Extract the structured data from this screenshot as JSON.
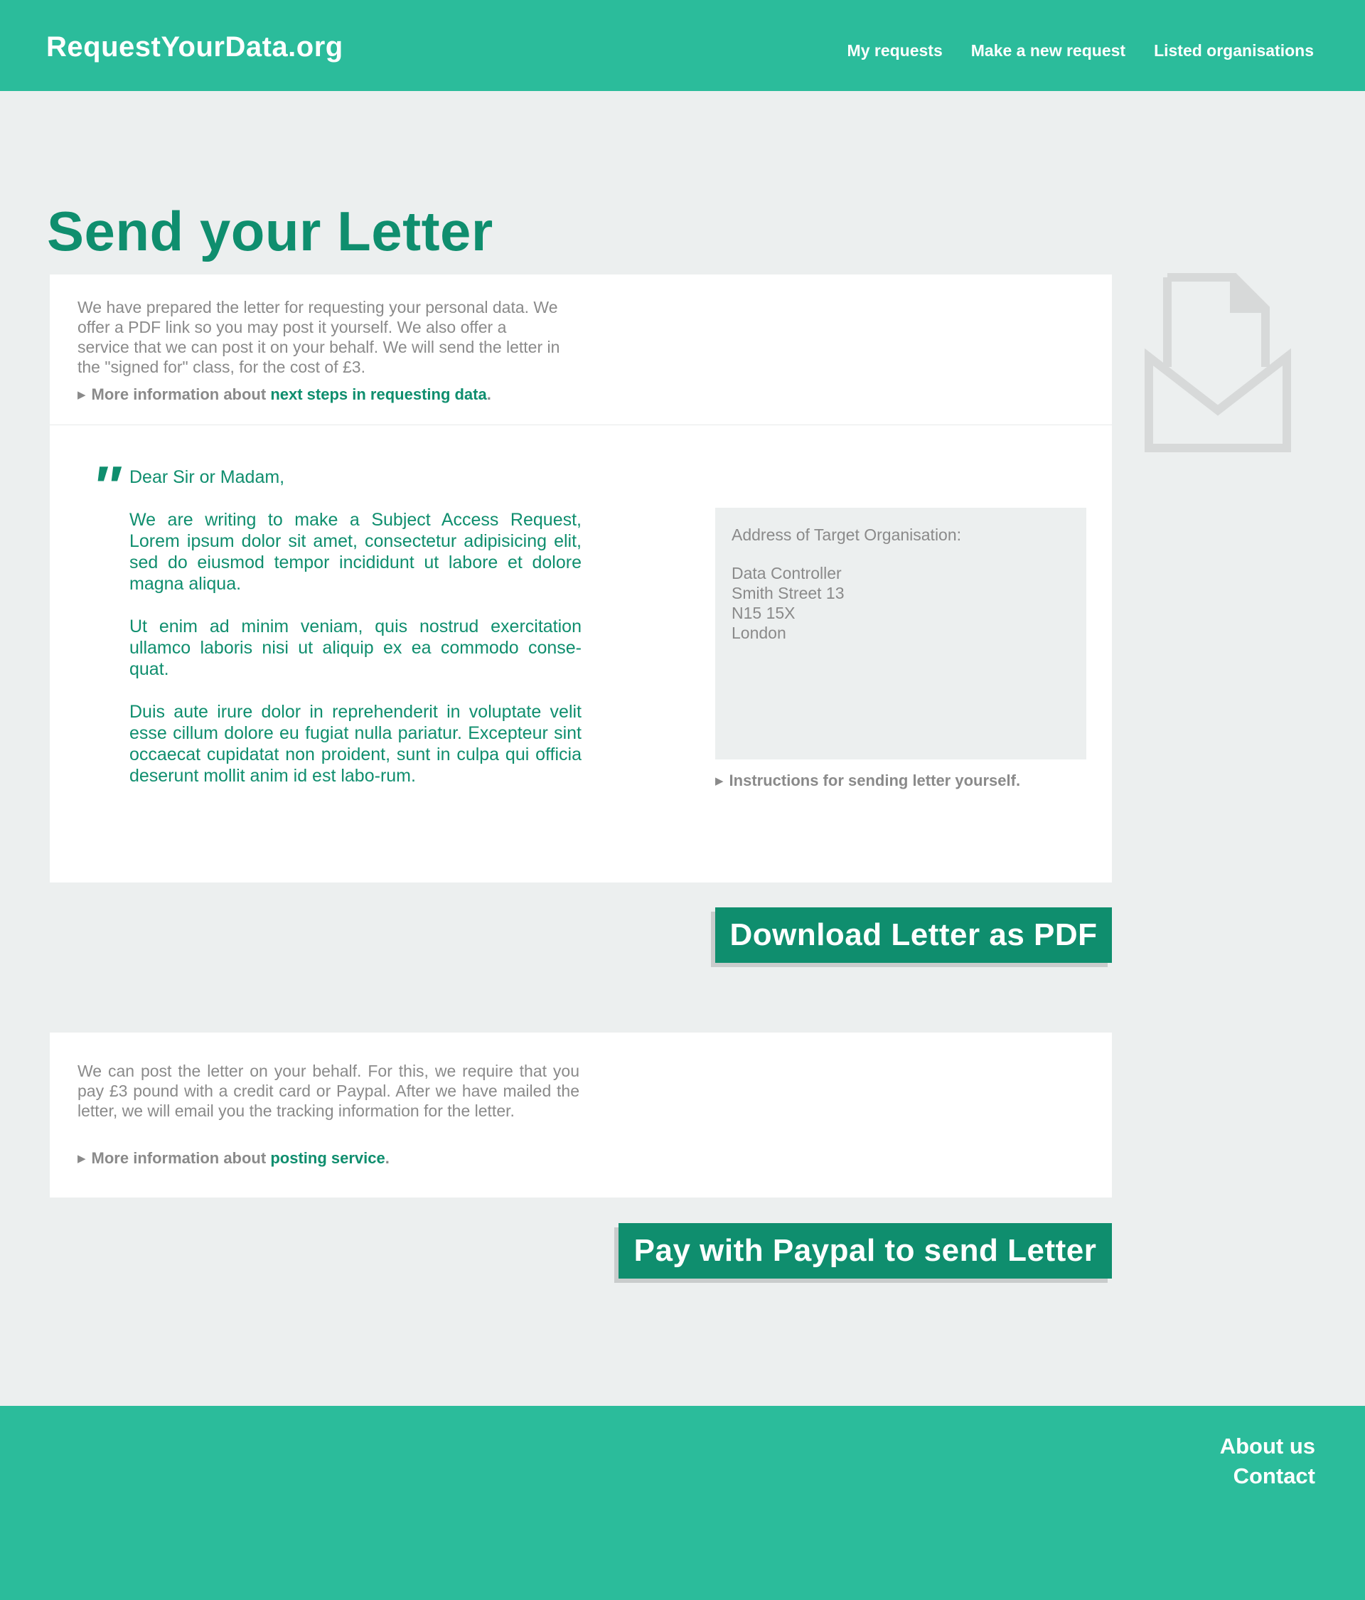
{
  "header": {
    "logo": "RequestYourData.org",
    "nav": [
      "My requests",
      "Make a new request",
      "Listed organisations"
    ]
  },
  "page": {
    "title": "Send your Letter"
  },
  "intro": {
    "text": "We have prepared the letter for requesting your personal data. We offer a PDF link so you may post it yourself. We also offer a service that we can post it on your behalf. We will send the letter in the \"signed for\" class, for the cost of £3.",
    "more_prefix": "More information about",
    "more_link": "next steps in requesting data",
    "more_suffix": "."
  },
  "letter": {
    "greeting": "Dear Sir or Madam,",
    "paragraphs": [
      "We are writing to make a Subject Access Request, Lorem ipsum dolor sit amet, consectetur adipisicing elit, sed do eiusmod tempor incididunt ut labore et dolore magna aliqua.",
      "Ut enim ad minim veniam, quis nostrud exercitation ullamco laboris nisi ut aliquip ex ea commodo conse-quat.",
      "Duis aute irure dolor in reprehenderit in voluptate velit esse cillum dolore eu fugiat nulla pariatur. Excepteur sint occaecat cupidatat non proident, sunt in culpa qui officia deserunt mollit anim id est labo-rum."
    ]
  },
  "address": {
    "label": "Address of Target Organisation:",
    "lines": [
      "Data Controller",
      "Smith Street 13",
      "N15 15X",
      "London"
    ]
  },
  "instructions": "Instructions for sending letter yourself.",
  "buttons": {
    "download_pdf": "Download Letter as PDF",
    "paypal": "Pay with Paypal to send Letter"
  },
  "posting": {
    "text": "We can post the letter on your behalf. For this, we require that you pay £3 pound with a credit card or Paypal. After we have mailed the letter, we will email you the tracking information for the letter.",
    "more_prefix": "More information about",
    "more_link": "posting service",
    "more_suffix": "."
  },
  "footer": {
    "links": [
      "About us",
      "Contact"
    ]
  },
  "icons": {
    "arrow": "triangle-right-icon",
    "envelope": "envelope-letter-icon",
    "quote": "quote-icon"
  },
  "colors": {
    "brand": "#2bbc9b",
    "accent": "#0f8e6e",
    "background": "#ecefef",
    "text_muted": "#8a8a8a"
  }
}
